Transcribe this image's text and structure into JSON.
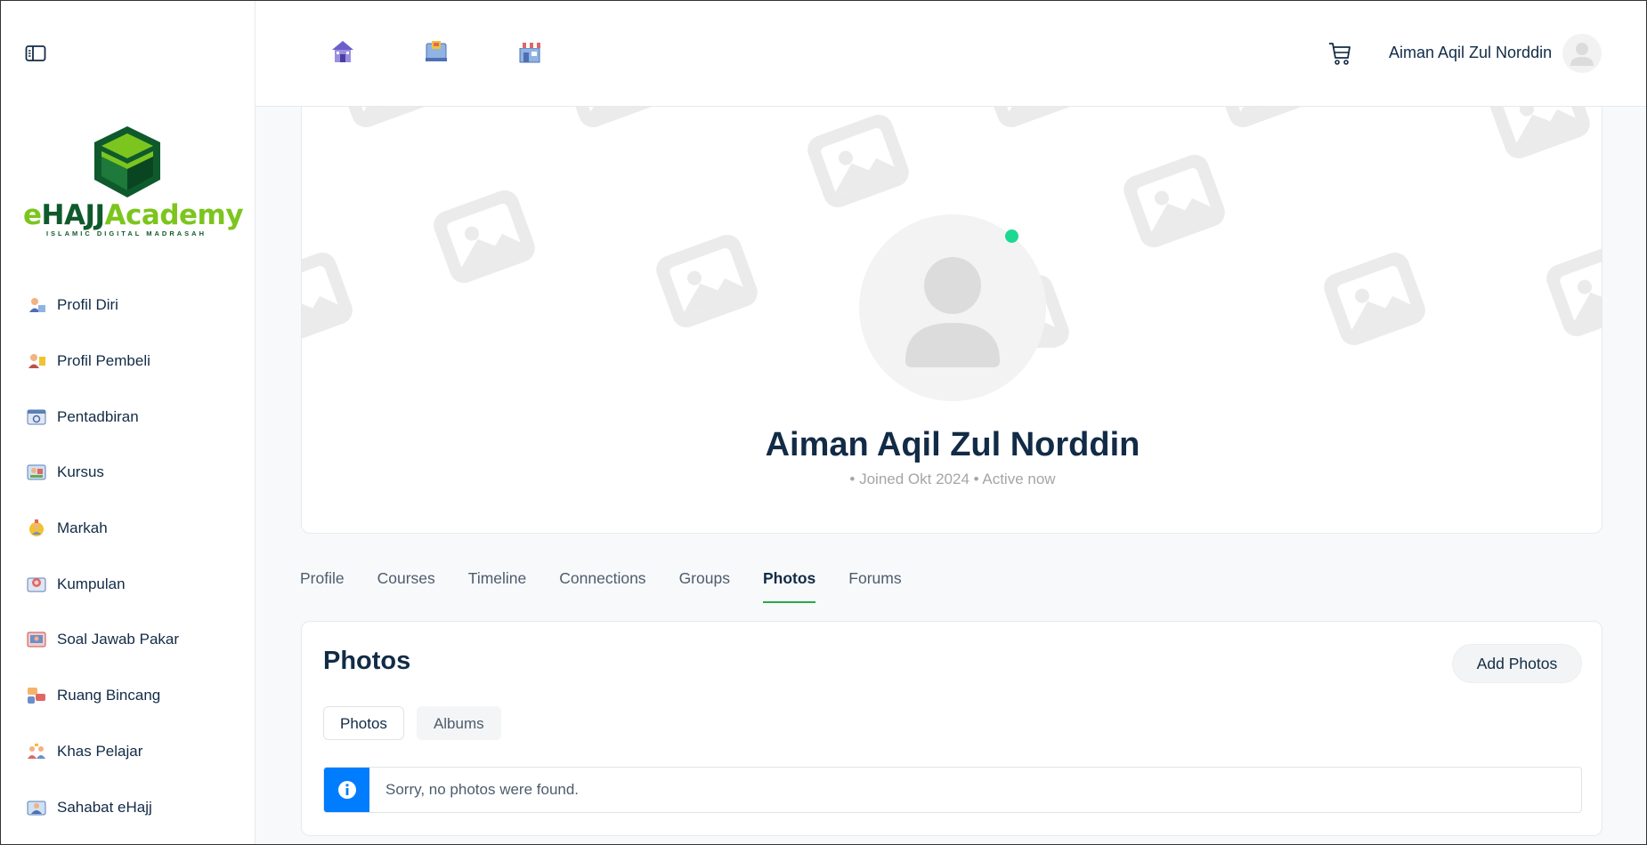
{
  "header": {
    "user_name": "Aiman Aqil Zul Norddin",
    "nav_icons": [
      "home-icon",
      "courses-icon",
      "store-icon"
    ]
  },
  "logo": {
    "part_e": "e",
    "part_hajj": "HAJJ",
    "part_academy": "Academy",
    "tagline": "ISLAMIC DIGITAL MADRASAH"
  },
  "sidebar": {
    "items": [
      {
        "label": "Profil Diri",
        "icon": "profile-icon"
      },
      {
        "label": "Profil Pembeli",
        "icon": "buyer-icon"
      },
      {
        "label": "Pentadbiran",
        "icon": "admin-icon"
      },
      {
        "label": "Kursus",
        "icon": "course-icon"
      },
      {
        "label": "Markah",
        "icon": "grade-icon"
      },
      {
        "label": "Kumpulan",
        "icon": "group-icon"
      },
      {
        "label": "Soal Jawab Pakar",
        "icon": "qa-icon"
      },
      {
        "label": "Ruang Bincang",
        "icon": "discussion-icon"
      },
      {
        "label": "Khas Pelajar",
        "icon": "student-icon"
      },
      {
        "label": "Sahabat eHajj",
        "icon": "friends-icon"
      }
    ]
  },
  "profile": {
    "name": "Aiman Aqil Zul Norddin",
    "meta": "• Joined Okt 2024 • Active now",
    "online_color": "#1cd991"
  },
  "tabs": [
    {
      "label": "Profile",
      "active": false
    },
    {
      "label": "Courses",
      "active": false
    },
    {
      "label": "Timeline",
      "active": false
    },
    {
      "label": "Connections",
      "active": false
    },
    {
      "label": "Groups",
      "active": false
    },
    {
      "label": "Photos",
      "active": true
    },
    {
      "label": "Forums",
      "active": false
    }
  ],
  "photos": {
    "title": "Photos",
    "add_button": "Add Photos",
    "subtabs": [
      "Photos",
      "Albums"
    ],
    "notice": "Sorry, no photos were found."
  },
  "colors": {
    "accent_green": "#2aa84a",
    "info_blue": "#007CFF",
    "text_dark": "#122B46"
  }
}
